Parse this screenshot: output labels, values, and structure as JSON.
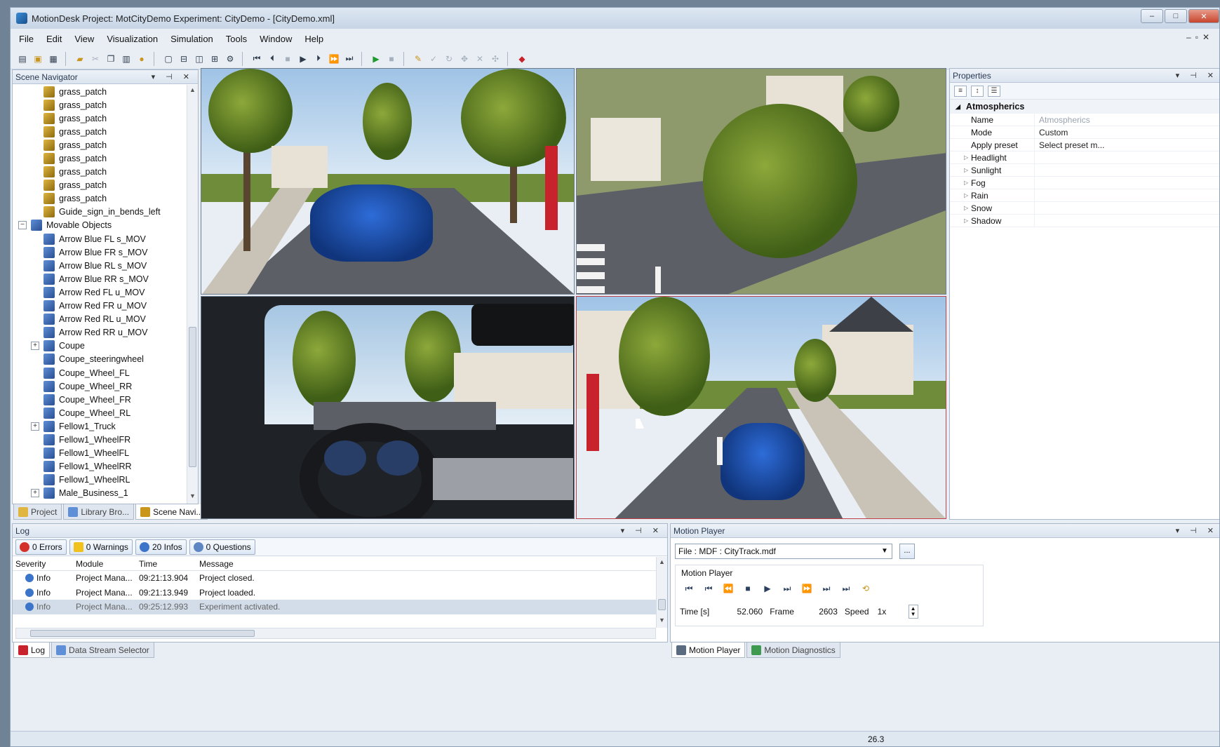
{
  "window": {
    "title": "MotionDesk  Project: MotCityDemo  Experiment: CityDemo - [CityDemo.xml]",
    "controls": [
      "–",
      "□",
      "✕"
    ]
  },
  "menu": [
    "File",
    "Edit",
    "View",
    "Visualization",
    "Simulation",
    "Tools",
    "Window",
    "Help"
  ],
  "scene_navigator": {
    "title": "Scene Navigator",
    "items": [
      {
        "label": "grass_patch",
        "type": "grass",
        "indent": 2,
        "expander": ""
      },
      {
        "label": "grass_patch",
        "type": "grass",
        "indent": 2,
        "expander": ""
      },
      {
        "label": "grass_patch",
        "type": "grass",
        "indent": 2,
        "expander": ""
      },
      {
        "label": "grass_patch",
        "type": "grass",
        "indent": 2,
        "expander": ""
      },
      {
        "label": "grass_patch",
        "type": "grass",
        "indent": 2,
        "expander": ""
      },
      {
        "label": "grass_patch",
        "type": "grass",
        "indent": 2,
        "expander": ""
      },
      {
        "label": "grass_patch",
        "type": "grass",
        "indent": 2,
        "expander": ""
      },
      {
        "label": "grass_patch",
        "type": "grass",
        "indent": 2,
        "expander": ""
      },
      {
        "label": "grass_patch",
        "type": "grass",
        "indent": 2,
        "expander": ""
      },
      {
        "label": "Guide_sign_in_bends_left",
        "type": "grass",
        "indent": 2,
        "expander": ""
      },
      {
        "label": "Movable Objects",
        "type": "obj",
        "indent": 1,
        "expander": "−"
      },
      {
        "label": "Arrow Blue FL s_MOV",
        "type": "obj",
        "indent": 2,
        "expander": ""
      },
      {
        "label": "Arrow Blue FR s_MOV",
        "type": "obj",
        "indent": 2,
        "expander": ""
      },
      {
        "label": "Arrow Blue RL s_MOV",
        "type": "obj",
        "indent": 2,
        "expander": ""
      },
      {
        "label": "Arrow Blue RR s_MOV",
        "type": "obj",
        "indent": 2,
        "expander": ""
      },
      {
        "label": "Arrow Red FL u_MOV",
        "type": "obj",
        "indent": 2,
        "expander": ""
      },
      {
        "label": "Arrow Red FR u_MOV",
        "type": "obj",
        "indent": 2,
        "expander": ""
      },
      {
        "label": "Arrow Red RL u_MOV",
        "type": "obj",
        "indent": 2,
        "expander": ""
      },
      {
        "label": "Arrow Red RR u_MOV",
        "type": "obj",
        "indent": 2,
        "expander": ""
      },
      {
        "label": "Coupe",
        "type": "obj",
        "indent": 2,
        "expander": "+"
      },
      {
        "label": "Coupe_steeringwheel",
        "type": "obj",
        "indent": 2,
        "expander": ""
      },
      {
        "label": "Coupe_Wheel_FL",
        "type": "obj",
        "indent": 2,
        "expander": ""
      },
      {
        "label": "Coupe_Wheel_RR",
        "type": "obj",
        "indent": 2,
        "expander": ""
      },
      {
        "label": "Coupe_Wheel_FR",
        "type": "obj",
        "indent": 2,
        "expander": ""
      },
      {
        "label": "Coupe_Wheel_RL",
        "type": "obj",
        "indent": 2,
        "expander": ""
      },
      {
        "label": "Fellow1_Truck",
        "type": "obj",
        "indent": 2,
        "expander": "+"
      },
      {
        "label": "Fellow1_WheelFR",
        "type": "obj",
        "indent": 2,
        "expander": ""
      },
      {
        "label": "Fellow1_WheelFL",
        "type": "obj",
        "indent": 2,
        "expander": ""
      },
      {
        "label": "Fellow1_WheelRR",
        "type": "obj",
        "indent": 2,
        "expander": ""
      },
      {
        "label": "Fellow1_WheelRL",
        "type": "obj",
        "indent": 2,
        "expander": ""
      },
      {
        "label": "Male_Business_1",
        "type": "obj",
        "indent": 2,
        "expander": "+"
      }
    ],
    "tabs": [
      "Project",
      "Library Bro...",
      "Scene Navi..."
    ]
  },
  "properties": {
    "title": "Properties",
    "category": "Atmospherics",
    "rows": [
      {
        "name": "Name",
        "value": "Atmospherics",
        "muted": true,
        "expandable": false
      },
      {
        "name": "Mode",
        "value": "Custom",
        "muted": false,
        "expandable": false
      },
      {
        "name": "Apply preset",
        "value": "Select preset m...",
        "muted": false,
        "expandable": false
      },
      {
        "name": "Headlight",
        "value": "",
        "muted": false,
        "expandable": true
      },
      {
        "name": "Sunlight",
        "value": "",
        "muted": false,
        "expandable": true
      },
      {
        "name": "Fog",
        "value": "",
        "muted": false,
        "expandable": true
      },
      {
        "name": "Rain",
        "value": "",
        "muted": false,
        "expandable": true
      },
      {
        "name": "Snow",
        "value": "",
        "muted": false,
        "expandable": true
      },
      {
        "name": "Shadow",
        "value": "",
        "muted": false,
        "expandable": true
      }
    ]
  },
  "log": {
    "title": "Log",
    "filters": {
      "errors": "0 Errors",
      "warnings": "0 Warnings",
      "infos": "20 Infos",
      "questions": "0 Questions"
    },
    "columns": [
      "Severity",
      "Module",
      "Time",
      "Message"
    ],
    "rows": [
      {
        "severity": "Info",
        "module": "Project Mana...",
        "time": "09:21:13.904",
        "message": "Project closed."
      },
      {
        "severity": "Info",
        "module": "Project Mana...",
        "time": "09:21:13.949",
        "message": "Project loaded."
      },
      {
        "severity": "Info",
        "module": "Project Mana...",
        "time": "09:25:12.993",
        "message": "Experiment activated."
      }
    ],
    "tabs": [
      "Log",
      "Data Stream Selector"
    ]
  },
  "motion_player": {
    "title": "Motion Player",
    "file": "File : MDF : CityTrack.mdf",
    "browse": "...",
    "group_label": "Motion Player",
    "controls": [
      "⏮",
      "⏮",
      "⏪",
      "■",
      "▶",
      "⏭",
      "⏩",
      "⏭",
      "⏭"
    ],
    "time_label": "Time [s]",
    "time_value": "52.060",
    "frame_label": "Frame",
    "frame_value": "2603",
    "speed_label": "Speed",
    "speed_value": "1x",
    "tabs": [
      "Motion Player",
      "Motion Diagnostics"
    ]
  },
  "status": {
    "value": "26.3"
  },
  "colors": {
    "accent": "#3b74c8",
    "viewport_active_border": "#c0404a",
    "car": "#1f55c0"
  }
}
